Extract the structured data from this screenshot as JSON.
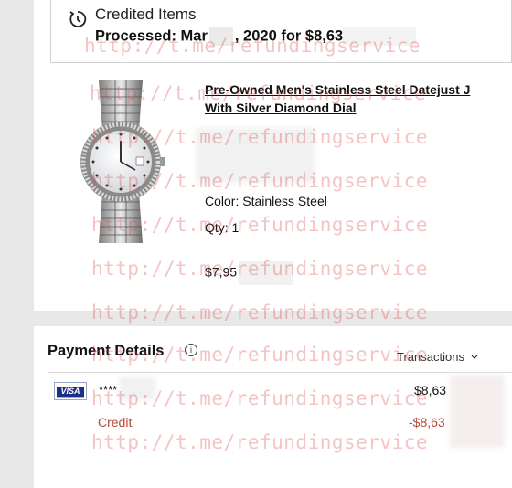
{
  "credited": {
    "title": "Credited Items",
    "processed_prefix": "Processed: Mar",
    "processed_suffix": ", 2020 for $8,63"
  },
  "product": {
    "title_line1": "Pre-Owned Men's Stainless Steel Datejust J",
    "title_line2": "With Silver Diamond Dial",
    "color": "Color: Stainless Steel",
    "qty": "Qty: 1",
    "price": "$7,95"
  },
  "payment": {
    "title": "Payment Details",
    "info_glyph": "i",
    "transactions_label": "Transactions",
    "card_brand": "VISA",
    "masked": "****",
    "amount": "$8,63",
    "credit_label": "Credit",
    "credit_amount": "-$8,63"
  },
  "watermark": "http://t.me/refundingservice",
  "icons": [
    "refresh-icon",
    "info-icon",
    "chevron-down-icon",
    "visa-icon"
  ],
  "colors": {
    "credit_red": "#b5473a",
    "watermark": "#dc4646",
    "visa_blue": "#1a2d8a"
  }
}
